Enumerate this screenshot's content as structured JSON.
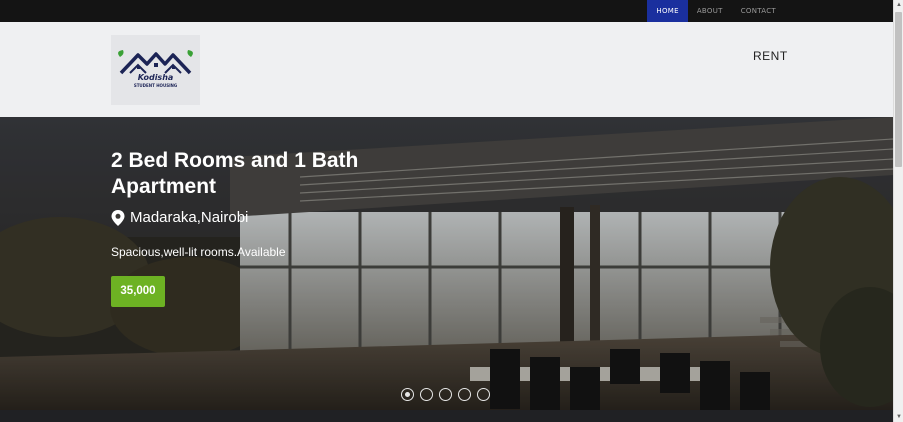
{
  "topnav": {
    "items": [
      {
        "label": "HOME",
        "active": true
      },
      {
        "label": "ABOUT",
        "active": false
      },
      {
        "label": "CONTACT",
        "active": false
      }
    ]
  },
  "header": {
    "logo": {
      "name": "Kodisha",
      "subtitle": "STUDENT HOUSING"
    },
    "rent_label": "RENT"
  },
  "hero": {
    "title": "2 Bed Rooms and 1 Bath Apartment",
    "location": "Madaraka,Nairobi",
    "location_icon": "map-pin-icon",
    "description": "Spacious,well-lit rooms.Available",
    "price": "35,000",
    "slides": {
      "count": 5,
      "active_index": 0
    }
  },
  "colors": {
    "nav_active": "#1a2f9e",
    "price_badge": "#6db223",
    "header_bg": "#eff0f2",
    "topbar_bg": "#141414",
    "logo_navy": "#1c2456",
    "logo_leaf": "#3aa136"
  }
}
